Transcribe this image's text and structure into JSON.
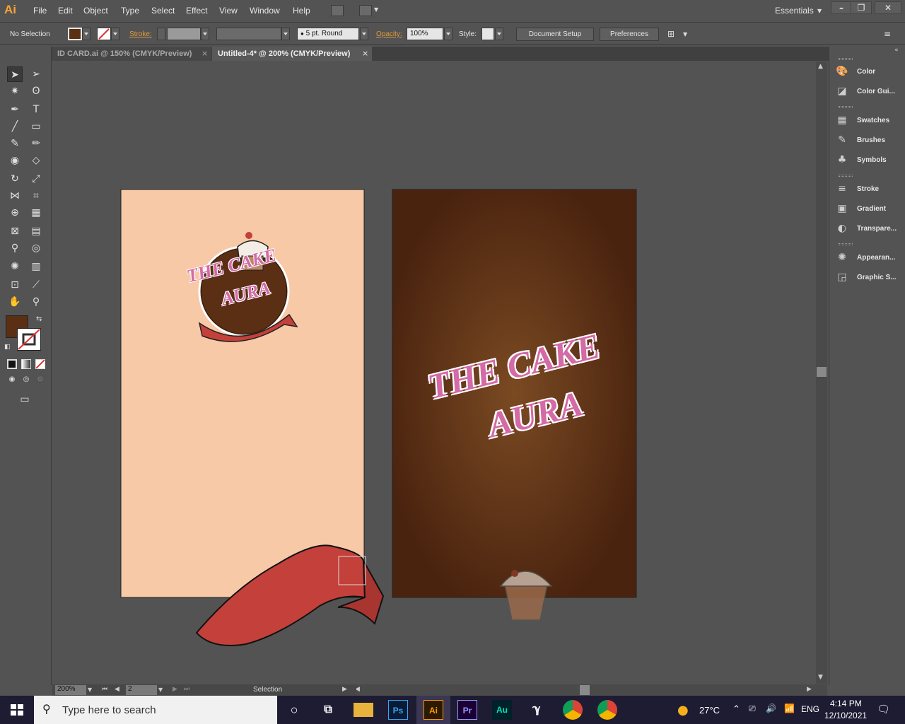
{
  "app": {
    "logo": "Ai",
    "workspace": "Essentials"
  },
  "menu": [
    "File",
    "Edit",
    "Object",
    "Type",
    "Select",
    "Effect",
    "View",
    "Window",
    "Help"
  ],
  "control_bar": {
    "selection": "No Selection",
    "stroke_label": "Stroke:",
    "brush": "5 pt. Round",
    "opacity_label": "Opacity:",
    "opacity_value": "100%",
    "style_label": "Style:",
    "document_setup": "Document Setup",
    "preferences": "Preferences"
  },
  "tabs": [
    {
      "label": "ID CARD.ai @ 150% (CMYK/Preview)",
      "close": "×"
    },
    {
      "label": "Untitled-4* @ 200% (CMYK/Preview)",
      "close": "×"
    }
  ],
  "artwork": {
    "logo_line1": "THE CAKE",
    "logo_line2": "AURA",
    "colors": {
      "left_artboard": "#f7c9a7",
      "brown_dark": "#4a230f",
      "brown_light": "#7a4a22",
      "ribbon": "#c4403a",
      "pink_text": "#d46aa6"
    }
  },
  "status": {
    "zoom": "200%",
    "page": "2",
    "tool": "Selection"
  },
  "panels": [
    {
      "label": "Color",
      "icon": "palette-icon"
    },
    {
      "label": "Color Gui...",
      "icon": "color-guide-icon"
    },
    {
      "label": "Swatches",
      "icon": "swatches-icon"
    },
    {
      "label": "Brushes",
      "icon": "brushes-icon"
    },
    {
      "label": "Symbols",
      "icon": "symbols-icon"
    },
    {
      "label": "Stroke",
      "icon": "stroke-icon"
    },
    {
      "label": "Gradient",
      "icon": "gradient-icon"
    },
    {
      "label": "Transpare...",
      "icon": "transparency-icon"
    },
    {
      "label": "Appearan...",
      "icon": "appearance-icon"
    },
    {
      "label": "Graphic S...",
      "icon": "graphic-styles-icon"
    }
  ],
  "taskbar": {
    "search_placeholder": "Type here to search",
    "weather": "27°C",
    "language": "ENG",
    "time": "4:14 PM",
    "date": "12/10/2021",
    "apps": {
      "ps": "Ps",
      "ai": "Ai",
      "pr": "Pr",
      "au": "Au"
    }
  }
}
